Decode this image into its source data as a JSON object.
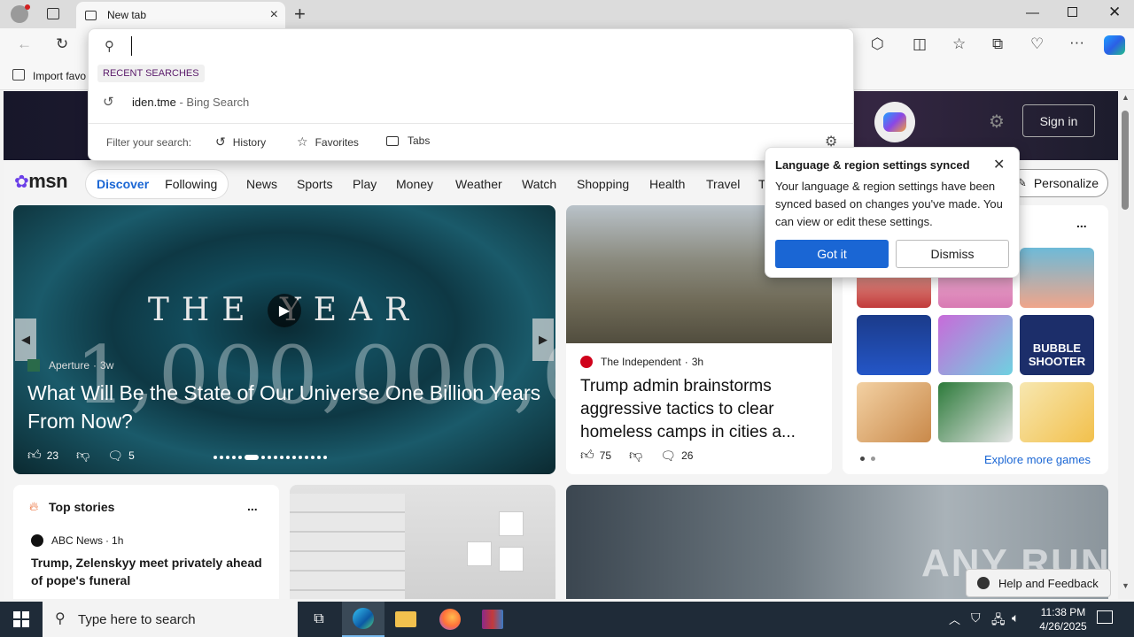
{
  "browser": {
    "tab_title": "New tab",
    "favorites_bar_item": "Import favo"
  },
  "omnibox": {
    "value": "",
    "recent_header": "RECENT SEARCHES",
    "recent_item_query": "iden.tme",
    "recent_item_source": " - Bing Search",
    "filter_label": "Filter your search:",
    "filters": [
      "History",
      "Favorites",
      "Tabs"
    ]
  },
  "msn": {
    "sign_in": "Sign in",
    "logo": "msn",
    "tabs": [
      "Discover",
      "Following"
    ],
    "nav": [
      "News",
      "Sports",
      "Play",
      "Money",
      "Weather",
      "Watch",
      "Shopping",
      "Health",
      "Travel",
      "T"
    ],
    "personalize": "Personalize"
  },
  "hero_story": {
    "overlay_line1": "THE  YEAR",
    "overlay_line2": "1,000,000,000",
    "source": "Aperture",
    "age": "3w",
    "title": "What Will Be the State of Our Universe One Billion Years From Now?",
    "likes": "23",
    "comments": "5"
  },
  "news_story": {
    "source": "The Independent",
    "age": "3h",
    "title": "Trump admin brainstorms aggressive tactics to clear homeless camps in cities a...",
    "likes": "75",
    "comments": "26"
  },
  "games": {
    "explore_link": "Explore more games",
    "more": "...",
    "tile_text": "BUBBLE SHOOTER"
  },
  "top_stories": {
    "header": "Top stories",
    "more": "...",
    "source": "ABC News",
    "age": "1h",
    "headline": "Trump, Zelenskyy meet privately ahead of pope's funeral"
  },
  "popup": {
    "title": "Language & region settings synced",
    "body": "Your language & region settings have been synced based on changes you've made. You can view or edit these settings.",
    "primary": "Got it",
    "secondary": "Dismiss"
  },
  "help_feedback": "Help and Feedback",
  "watermark": "ANY RUN",
  "taskbar": {
    "search_placeholder": "Type here to search",
    "time": "11:38 PM",
    "date": "4/26/2025"
  },
  "colors": {
    "accent_blue": "#1a66d4",
    "taskbar": "#1f2b38",
    "independent_red": "#d0021b"
  }
}
